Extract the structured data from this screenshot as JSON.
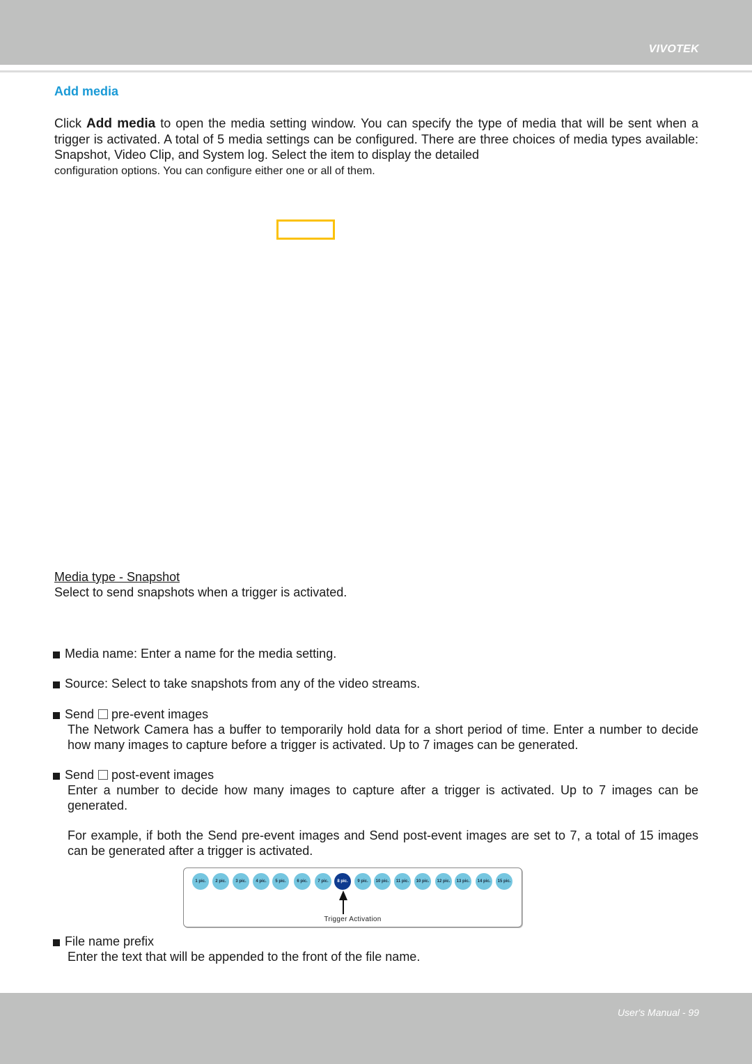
{
  "header": {
    "brand": "VIVOTEK"
  },
  "section": {
    "title": "Add media"
  },
  "intro": {
    "pre": "Click ",
    "bold": "Add media",
    "post": " to open the media setting window. You can specify the type of media that will be sent when a trigger is activated. A total of 5 media settings can be configured. There are three choices of media types available: Snapshot, Video Clip, and System log. Select the item to display the detailed",
    "last_line": "configuration options. You can configure either one or all of them."
  },
  "media_type": {
    "heading": "Media type - Snapshot ",
    "description": "Select to send snapshots when a trigger is activated."
  },
  "items": {
    "media_name": "Media name: Enter a name for the media setting.",
    "source": "Source: Select to take snapshots from any of the video streams.",
    "pre_event": {
      "send": "Send",
      "label": "pre-event images",
      "desc": "The Network Camera has a buffer to temporarily hold data for a short period of time. Enter a number to decide how many images to capture before a trigger is activated. Up to 7 images can be generated."
    },
    "post_event": {
      "send": "Send",
      "label": "post-event images",
      "desc": "Enter a number to decide how many images to capture after a trigger is activated. Up to 7 images can be generated.",
      "example": "For example, if both the Send pre-event images and Send post-event images are set to 7, a total of 15 images can be generated after a trigger is activated."
    },
    "file_prefix": {
      "label": "File name prefix",
      "desc": "Enter the text that will be appended to the front of the file name."
    }
  },
  "diagram": {
    "pics": [
      "1 pic.",
      "2 pic.",
      "3 pic.",
      "4 pic.",
      "5 pic.",
      "6 pic.",
      "7 pic.",
      "8 pic.",
      "9 pic.",
      "10 pic.",
      "11 pic.",
      "10 pic.",
      "12 pic.",
      "13 pic.",
      "14 pic.",
      "15 pic."
    ],
    "active_index": 7,
    "colors": {
      "inactive": "#75c6e0",
      "active": "#0e3b8f"
    },
    "trigger_label": "Trigger Activation"
  },
  "footer": {
    "page_label": "User's Manual - 99"
  }
}
